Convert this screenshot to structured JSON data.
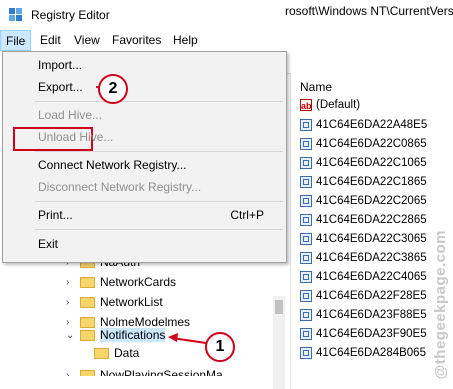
{
  "window": {
    "title": "Registry Editor",
    "app_icon": "registry-editor-icon"
  },
  "menubar": [
    "File",
    "Edit",
    "View",
    "Favorites",
    "Help"
  ],
  "address": "rosoft\\Windows NT\\CurrentVersi",
  "file_menu": {
    "items": [
      {
        "label": "Import...",
        "enabled": true
      },
      {
        "label": "Export...",
        "enabled": true
      },
      {
        "label": "Load Hive...",
        "enabled": false
      },
      {
        "label": "Unload Hive...",
        "enabled": false
      },
      {
        "label": "Connect Network Registry...",
        "enabled": true
      },
      {
        "label": "Disconnect Network Registry...",
        "enabled": false
      },
      {
        "label": "Print...",
        "enabled": true,
        "shortcut": "Ctrl+P"
      },
      {
        "label": "Exit",
        "enabled": true
      }
    ]
  },
  "tree": [
    {
      "label": "NaAuth",
      "expanded": false
    },
    {
      "label": "NetworkCards",
      "expanded": false
    },
    {
      "label": "NetworkList",
      "expanded": false
    },
    {
      "label": "NolmeModelmes",
      "expanded": false
    },
    {
      "label": "Notifications",
      "expanded": true,
      "selected": true
    },
    {
      "label": "Data",
      "child": true
    },
    {
      "label": "NowPlayingSessionMa",
      "expanded": false
    }
  ],
  "values_pane": {
    "column_header": "Name",
    "rows": [
      {
        "name": "(Default)",
        "icon": "string-value-icon"
      },
      {
        "name": "41C64E6DA22A48E5",
        "icon": "binary-value-icon"
      },
      {
        "name": "41C64E6DA22C0865",
        "icon": "binary-value-icon"
      },
      {
        "name": "41C64E6DA22C1065",
        "icon": "binary-value-icon"
      },
      {
        "name": "41C64E6DA22C1865",
        "icon": "binary-value-icon"
      },
      {
        "name": "41C64E6DA22C2065",
        "icon": "binary-value-icon"
      },
      {
        "name": "41C64E6DA22C2865",
        "icon": "binary-value-icon"
      },
      {
        "name": "41C64E6DA22C3065",
        "icon": "binary-value-icon"
      },
      {
        "name": "41C64E6DA22C3865",
        "icon": "binary-value-icon"
      },
      {
        "name": "41C64E6DA22C4065",
        "icon": "binary-value-icon"
      },
      {
        "name": "41C64E6DA22F28E5",
        "icon": "binary-value-icon"
      },
      {
        "name": "41C64E6DA23F88E5",
        "icon": "binary-value-icon"
      },
      {
        "name": "41C64E6DA23F90E5",
        "icon": "binary-value-icon"
      },
      {
        "name": "41C64E6DA284B065",
        "icon": "binary-value-icon"
      }
    ]
  },
  "annotations": {
    "step1": "1",
    "step2": "2",
    "accent": "#d0001a"
  },
  "watermark": "@thegeekpage.com"
}
